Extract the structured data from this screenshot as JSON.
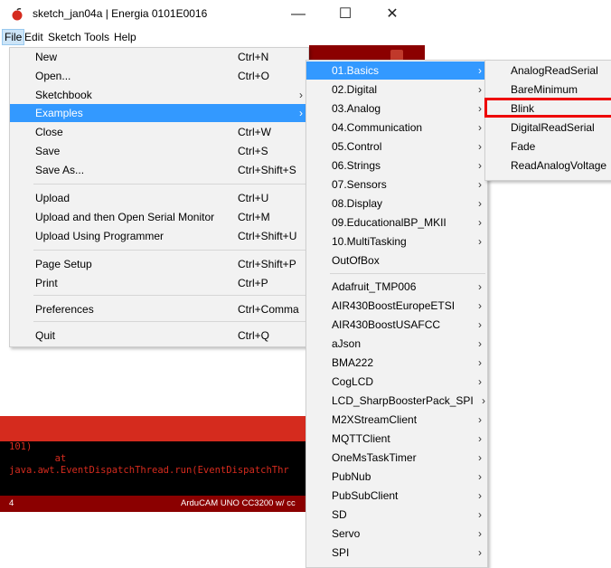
{
  "window": {
    "title": "sketch_jan04a | Energia 0101E0016",
    "minimize_glyph": "—",
    "maximize_glyph": "☐",
    "close_glyph": "✕"
  },
  "menubar": {
    "items": [
      "File",
      "Edit",
      "Sketch",
      "Tools",
      "Help"
    ]
  },
  "file_menu": {
    "items": [
      {
        "label": "New",
        "shortcut": "Ctrl+N"
      },
      {
        "label": "Open...",
        "shortcut": "Ctrl+O"
      },
      {
        "label": "Sketchbook",
        "shortcut": "",
        "submenu": true
      },
      {
        "label": "Examples",
        "shortcut": "",
        "submenu": true,
        "highlighted": true
      },
      {
        "label": "Close",
        "shortcut": "Ctrl+W"
      },
      {
        "label": "Save",
        "shortcut": "Ctrl+S"
      },
      {
        "label": "Save As...",
        "shortcut": "Ctrl+Shift+S"
      },
      {
        "label": "Upload",
        "shortcut": "Ctrl+U"
      },
      {
        "label": "Upload and then Open Serial Monitor",
        "shortcut": "Ctrl+M"
      },
      {
        "label": "Upload Using Programmer",
        "shortcut": "Ctrl+Shift+U"
      },
      {
        "label": "Page Setup",
        "shortcut": "Ctrl+Shift+P"
      },
      {
        "label": "Print",
        "shortcut": "Ctrl+P"
      },
      {
        "label": "Preferences",
        "shortcut": "Ctrl+Comma"
      },
      {
        "label": "Quit",
        "shortcut": "Ctrl+Q"
      }
    ]
  },
  "examples_menu": {
    "items": [
      "01.Basics",
      "02.Digital",
      "03.Analog",
      "04.Communication",
      "05.Control",
      "06.Strings",
      "07.Sensors",
      "08.Display",
      "09.EducationalBP_MKII",
      "10.MultiTasking",
      "OutOfBox",
      "Adafruit_TMP006",
      "AIR430BoostEuropeETSI",
      "AIR430BoostUSAFCC",
      "aJson",
      "BMA222",
      "CogLCD",
      "LCD_SharpBoosterPack_SPI",
      "M2XStreamClient",
      "MQTTClient",
      "OneMsTaskTimer",
      "PubNub",
      "PubSubClient",
      "SD",
      "Servo",
      "SPI"
    ]
  },
  "basics_menu": {
    "items": [
      "AnalogReadSerial",
      "BareMinimum",
      "Blink",
      "DigitalReadSerial",
      "Fade",
      "ReadAnalogVoltage"
    ]
  },
  "console": {
    "line1": "101)",
    "line2": "        at",
    "line3": "java.awt.EventDispatchThread.run(EventDispatchThr"
  },
  "statusbar": {
    "line_number": "4",
    "board": "ArduCAM UNO CC3200 w/ cc"
  },
  "colors": {
    "highlight": "#3399ff",
    "annotation_red": "#ee0000",
    "error_red": "#d52b1e",
    "dark_red": "#8b0000"
  }
}
